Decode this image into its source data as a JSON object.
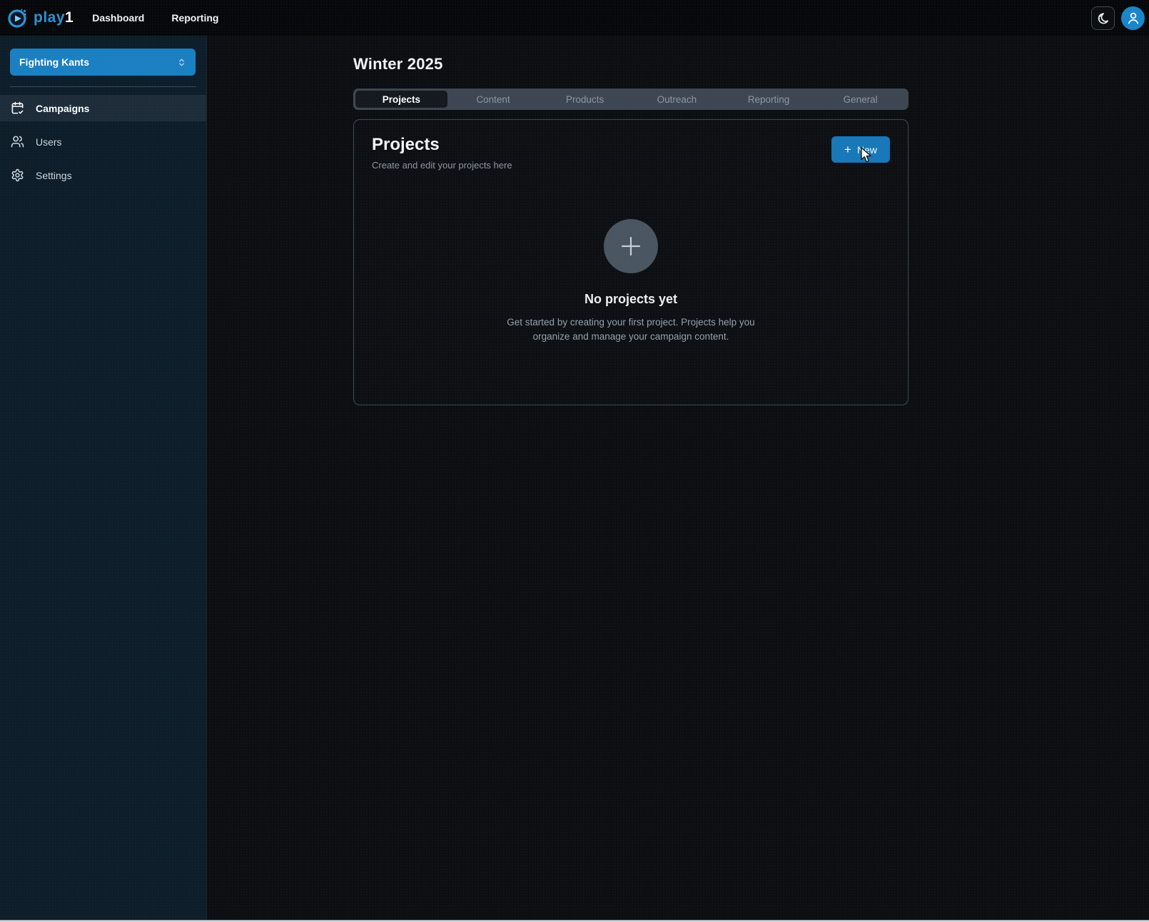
{
  "colors": {
    "accent_blue": "#1a80c2",
    "button_blue": "#1878ba",
    "avatar_blue": "#1a86c8",
    "topbar_bg": "#060709",
    "sidebar_bg": "#0d1d29",
    "main_bg": "#0c0e11",
    "panel_border": "#3e4a54",
    "tabbar_bg": "#3d4651",
    "active_tab_bg": "#15181d",
    "muted_text": "#8d97a3",
    "empty_circle_gray": "#4a5560"
  },
  "topbar": {
    "logo_text": "play",
    "logo_suffix": "1",
    "nav": [
      {
        "label": "Dashboard"
      },
      {
        "label": "Reporting"
      }
    ],
    "icons": [
      "moon-star-icon",
      "user-avatar-icon"
    ]
  },
  "sidebar": {
    "team_selector": "Fighting Kants",
    "items": [
      {
        "label": "Campaigns",
        "icon": "calendar-check-icon",
        "active": true
      },
      {
        "label": "Users",
        "icon": "users-icon",
        "active": false
      },
      {
        "label": "Settings",
        "icon": "gear-icon",
        "active": false
      }
    ]
  },
  "main": {
    "page_title": "Winter 2025",
    "tabs": [
      {
        "label": "Projects",
        "active": true
      },
      {
        "label": "Content",
        "active": false
      },
      {
        "label": "Products",
        "active": false
      },
      {
        "label": "Outreach",
        "active": false
      },
      {
        "label": "Reporting",
        "active": false
      },
      {
        "label": "General",
        "active": false
      }
    ],
    "panel": {
      "title": "Projects",
      "subtitle": "Create and edit your projects here",
      "new_button_plus": "+",
      "new_button_label": "New",
      "empty_state": {
        "title": "No projects yet",
        "description": "Get started by creating your first project. Projects help you organize and manage your campaign content."
      }
    }
  }
}
